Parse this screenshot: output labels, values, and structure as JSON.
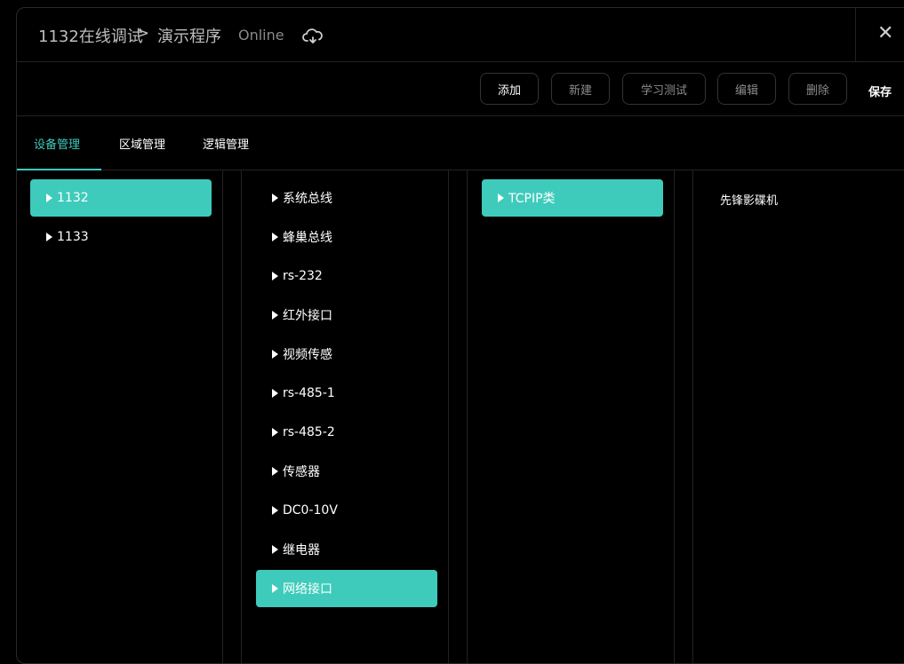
{
  "header": {
    "breadcrumb_device": "1132在线调试",
    "breadcrumb_separator": ">",
    "breadcrumb_program": "演示程序",
    "status": "Online",
    "cloud_icon": "cloud-sync-icon",
    "close_icon": "close-icon"
  },
  "toolbar": {
    "add_label": "添加",
    "new_label": "新建",
    "learn_test_label": "学习测试",
    "edit_label": "编辑",
    "delete_label": "删除",
    "save_label": "保存"
  },
  "tabs": {
    "device_mgmt": "设备管理",
    "area_mgmt": "区域管理",
    "logic_mgmt": "逻辑管理",
    "selected": "设备管理"
  },
  "devices": [
    {
      "label": "1132",
      "selected": true
    },
    {
      "label": "1133",
      "selected": false
    }
  ],
  "interfaces": [
    {
      "label": "系统总线",
      "selected": false
    },
    {
      "label": "蜂巢总线",
      "selected": false
    },
    {
      "label": "rs-232",
      "selected": false
    },
    {
      "label": "红外接口",
      "selected": false
    },
    {
      "label": "视频传感",
      "selected": false
    },
    {
      "label": "rs-485-1",
      "selected": false
    },
    {
      "label": "rs-485-2",
      "selected": false
    },
    {
      "label": "传感器",
      "selected": false
    },
    {
      "label": "DC0-10V",
      "selected": false
    },
    {
      "label": "继电器",
      "selected": false
    },
    {
      "label": "网络接口",
      "selected": true
    }
  ],
  "categories": [
    {
      "label": "TCPIP类",
      "selected": true
    }
  ],
  "models": [
    {
      "label": "先锋影碟机"
    }
  ],
  "colors": {
    "accent": "#3ecbbb",
    "background": "#000000"
  }
}
